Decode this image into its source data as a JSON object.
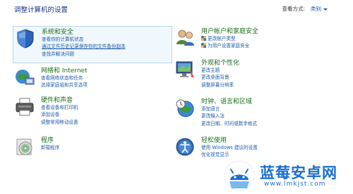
{
  "header": {
    "title": "调整计算机的设置",
    "view_by_label": "查看方式:",
    "view_by_value": "类别"
  },
  "categories": [
    {
      "title": "系统和安全",
      "icon": "shield-icon",
      "links": [
        "查看你的计算机状态",
        "通过文件历史记录保存你的文件备份副本",
        "查找并解决问题"
      ]
    },
    {
      "title": "网络和 Internet",
      "icon": "network-globe-icon",
      "links": [
        "查看网络状态和任务",
        "选择家庭组和共享选项"
      ]
    },
    {
      "title": "硬件和声音",
      "icon": "printer-icon",
      "links": [
        "查看设备和打印机",
        "添加设备",
        "调整常用移动设置"
      ]
    },
    {
      "title": "程序",
      "icon": "programs-disc-icon",
      "links": [
        "卸载程序"
      ]
    },
    {
      "title": "用户帐户和家庭安全",
      "icon": "users-icon",
      "links": [
        "更改帐户类型",
        "为用户设置家庭安全"
      ]
    },
    {
      "title": "外观和个性化",
      "icon": "appearance-monitor-icon",
      "links": [
        "更改主题",
        "更改桌面背景",
        "调整屏幕分辨率"
      ]
    },
    {
      "title": "时钟、语言和区域",
      "icon": "clock-globe-icon",
      "links": [
        "添加语言",
        "更改输入法",
        "更改日期、时间或数字格式"
      ]
    },
    {
      "title": "轻松使用",
      "icon": "ease-of-access-icon",
      "links": [
        "使用 Windows 建议的设置",
        "优化视觉显示"
      ]
    }
  ],
  "watermark": {
    "title": "蓝莓安卓网",
    "url": "www.lmkjst.com"
  },
  "colors": {
    "category_title": "#1a6e1a",
    "link": "#1b5aa6",
    "page_title": "#1e3287",
    "highlight_bg": "#f1f8fd",
    "highlight_border": "#b8d6ee",
    "watermark": "#1a6fd0"
  }
}
